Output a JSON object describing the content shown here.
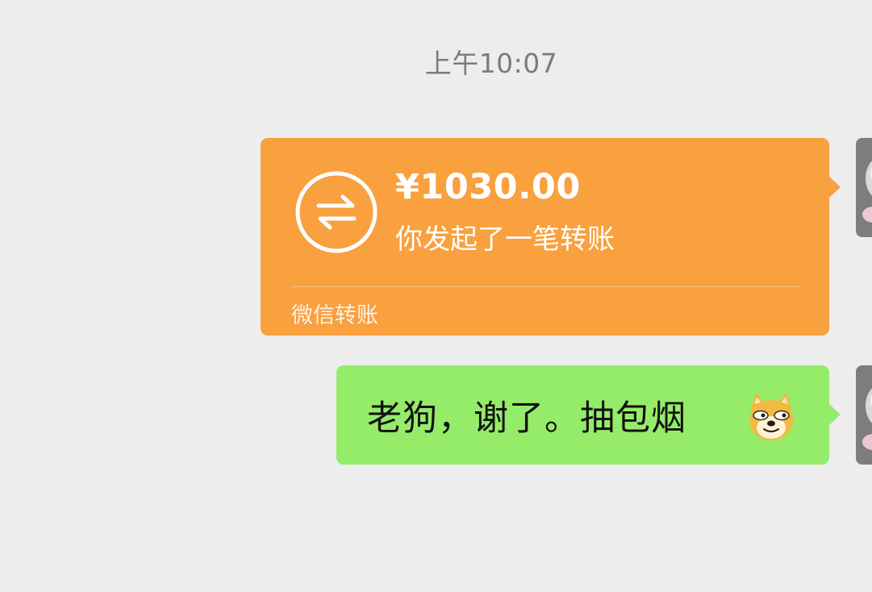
{
  "timestamp": "上午10:07",
  "messages": [
    {
      "type": "transfer",
      "amount": "¥1030.00",
      "description": "你发起了一笔转账",
      "footer": "微信转账",
      "icon": "transfer-arrows-icon",
      "color": "#f9a03f"
    },
    {
      "type": "text",
      "text": "老狗，谢了。抽包烟",
      "emoji": "doge-icon",
      "color": "#95ec69"
    }
  ],
  "colors": {
    "background": "#ededed",
    "timestamp": "#7b7b7b"
  }
}
